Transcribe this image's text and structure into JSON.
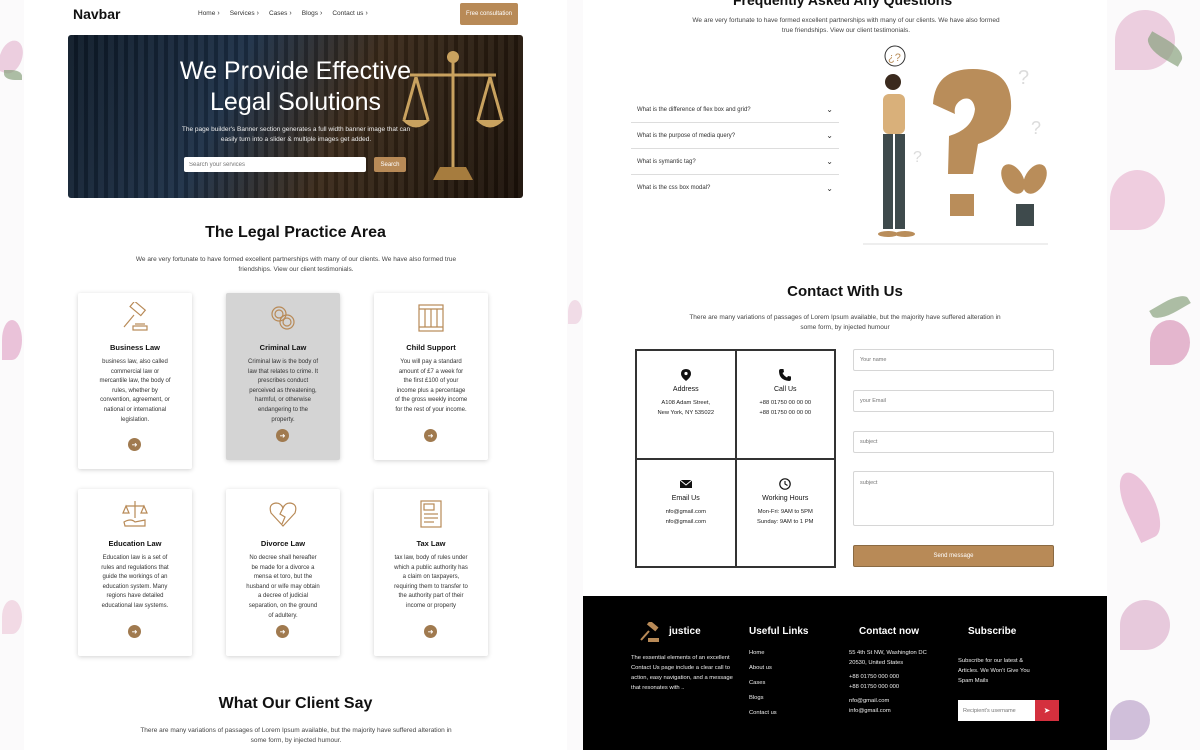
{
  "navbar": {
    "brand": "Navbar",
    "links": [
      "Home",
      "Services",
      "Cases",
      "Blogs",
      "Contact us"
    ],
    "cta": "Free consultation"
  },
  "hero": {
    "title_line1": "We Provide Effective",
    "title_line2": "Legal Solutions",
    "text": "The page builder's Banner section generates a full width banner image that can easily turn into a slider & multiple images get added.",
    "search_placeholder": "Search your services",
    "search_button": "Search"
  },
  "practice": {
    "title": "The Legal Practice Area",
    "subtitle": "We are very fortunate to have formed excellent partnerships with many of our clients. We have also formed true friendships. View our client testimonials.",
    "cards": [
      {
        "title": "Business Law",
        "text": "business law, also called commercial law or mercantile law, the body of rules, whether by convention, agreement, or national or international legislation.",
        "icon": "gavel-icon"
      },
      {
        "title": "Criminal Law",
        "text": "Criminal law is the body of law that relates to crime. It prescribes conduct perceived as threatening, harmful, or otherwise endangering to the property.",
        "icon": "handcuffs-icon"
      },
      {
        "title": "Child Support",
        "text": "You will pay a standard amount of £7 a week for the first £100 of your income plus a percentage of the gross weekly income for the rest of your income.",
        "icon": "jail-icon"
      },
      {
        "title": "Education Law",
        "text": "Education law is a set of rules and regulations that guide the workings of an education system. Many regions have detailed educational law systems.",
        "icon": "scales-hand-icon"
      },
      {
        "title": "Divorce Law",
        "text": "No decree shall hereafter be made for a divorce a mensa et toro, but the husband or wife may obtain a decree of judicial separation, on the ground of adultery.",
        "icon": "broken-heart-icon"
      },
      {
        "title": "Tax Law",
        "text": "tax law, body of rules under which a public authority has a claim on taxpayers, requiring them to transfer to the authority part of their income or property",
        "icon": "tax-document-icon"
      }
    ]
  },
  "testimonials": {
    "title": "What Our Client Say",
    "subtitle": "There are many variations of passages of Lorem Ipsum available, but the majority have suffered alteration in some form, by injected humour."
  },
  "faq": {
    "title": "Frequently Asked Any Questions",
    "subtitle": "We are very fortunate to have formed excellent partnerships with many of our clients. We have also formed true friendships. View our client testimonials.",
    "items": [
      "What is the difference of flex box and grid?",
      "What is the purpose of media query?",
      "What is symantic tag?",
      "What is the css box modal?"
    ]
  },
  "contact": {
    "title": "Contact With Us",
    "subtitle": "There are many variations of passages of Lorem Ipsum available, but the majority have suffered alteration in some form, by injected humour",
    "address": {
      "label": "Address",
      "line1": "A108 Adam Street,",
      "line2": "New York, NY 535022"
    },
    "call": {
      "label": "Call Us",
      "line1": "+88 01750 00 00 00",
      "line2": "+88 01750 00 00 00"
    },
    "email": {
      "label": "Email Us",
      "line1": "nfo@gmail.com",
      "line2": "nfo@gmail.com"
    },
    "hours": {
      "label": "Working Hours",
      "line1": "Mon-Fri: 9AM to 5PM",
      "line2": "Sunday: 9AM to 1 PM"
    },
    "form": {
      "name_placeholder": "Your name",
      "email_placeholder": "your Email",
      "subject_placeholder": "subject",
      "message_placeholder": "subject",
      "send": "Send message"
    }
  },
  "footer": {
    "brand": "justice",
    "about": "The essential elements of an excellent Contact Us page include a clear call to action, easy navigation, and a message that resonates with ..",
    "links_title": "Useful Links",
    "links": [
      "Home",
      "About us",
      "Cases",
      "Blogs",
      "Contact us"
    ],
    "contact_title": "Contact now",
    "contact_address": "55 4th St NW, Washington DC 20530, United States",
    "phone1": "+88 01750 000 000",
    "phone2": "+88 01750 000 000",
    "email1": "nfo@gmail.com",
    "email2": "info@gmail.com",
    "subscribe_title": "Subscribe",
    "subscribe_text": "Subscribe for our latest & Articles. We Won't Give You Spam Mails",
    "subscribe_placeholder": "Recipient's username"
  },
  "colors": {
    "accent": "#b88a57",
    "dark": "#000000",
    "danger": "#d4303e"
  }
}
